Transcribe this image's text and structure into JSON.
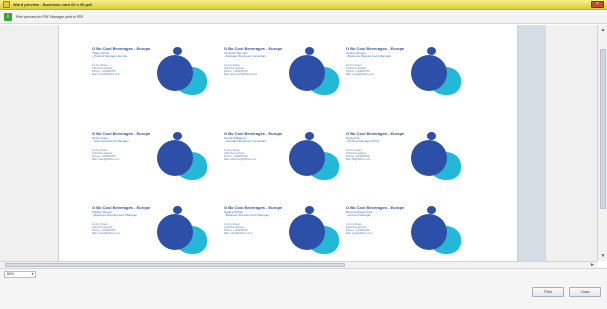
{
  "window": {
    "title": "Word preview - Business card 60 x 90.pdf",
    "close_icon": "close-icon"
  },
  "infobar": {
    "message": "Print preview for PDF Manager print to PDF"
  },
  "cards": [
    {
      "company": "O Bo Cool Beverages - Europe",
      "name": "Tiffany Smith",
      "role": "- Product Manager Europe",
      "address1": "12 Any Street",
      "address2": "1234 Somewhere",
      "phone": "Phone: +123456789",
      "email": "Mail: smith@tbtboo.com"
    },
    {
      "company": "O Bo Cool Beverages - Europe",
      "name": "Chrissira Beomkh",
      "role": "- Assistant Business Consultant",
      "address1": "12 Any Street",
      "address2": "1234 Somewhere",
      "phone": "Phone: +123456789",
      "email": "Mail: aberomkh@tbtboo.com"
    },
    {
      "company": "O Bo Cool Beverages - Europe",
      "name": "Neelam Reggs",
      "role": "- Business Development Manager",
      "address1": "12 Any Street",
      "address2": "1234 Somewhere",
      "phone": "Phone: +123456789",
      "email": "Mail: reggs@tbtboo.com"
    },
    {
      "company": "O Bo Cool Beverages - Europe",
      "name": "Quinn Tolan",
      "role": "- Communications Manager",
      "address1": "12 Any Street",
      "address2": "1234 Somewhere",
      "phone": "Phone: +123456789",
      "email": "Mail: tolan@tbtboo.com"
    },
    {
      "company": "O Bo Cool Beverages - Europe",
      "name": "Hamilt Williamon",
      "role": "- Assistant Business Consultant",
      "address1": "12 Any Street",
      "address2": "1234 Somewhere",
      "phone": "Phone: +123456789",
      "email": "Mail: williamon@tbtboo.com"
    },
    {
      "company": "O Bo Cool Beverages - Europe",
      "name": "Daniel Fill",
      "role": "- Product Manager Africa",
      "address1": "12 Any Street",
      "address2": "1234 Somewhere",
      "phone": "Phone: +123456789",
      "email": "Mail: fill@tbtboo.com"
    },
    {
      "company": "O Bo Cool Beverages - Europe",
      "name": "Dilshen Rivera",
      "role": "- Business Development Manager",
      "address1": "12 Any Street",
      "address2": "1234 Somewhere",
      "phone": "Phone: +123456789",
      "email": "Mail: rivera@tbtboo.com"
    },
    {
      "company": "O Bo Cool Beverages - Europe",
      "name": "Nadine Robelt",
      "role": "- Business Development Manager",
      "address1": "12 Any Street",
      "address2": "1234 Somewhere",
      "phone": "Phone: +123456789",
      "email": "Mail: robelt@tbtboo.com"
    },
    {
      "company": "O Bo Cool Beverages - Europe",
      "name": "Boureandrand Jeira",
      "role": "- Account Manager",
      "address1": "12 Any Street",
      "address2": "1234 Somewhere",
      "phone": "Phone: +123456789",
      "email": "Mail: jeira@tbtboo.com"
    }
  ],
  "footer": {
    "zoom": "80%",
    "print_button": "Print",
    "close_button": "Close"
  },
  "colors": {
    "brand_blue": "#2c4fa8",
    "brand_cyan": "#24b8d7",
    "title_bar": "#efe56a",
    "close_red": "#c64a2c"
  }
}
